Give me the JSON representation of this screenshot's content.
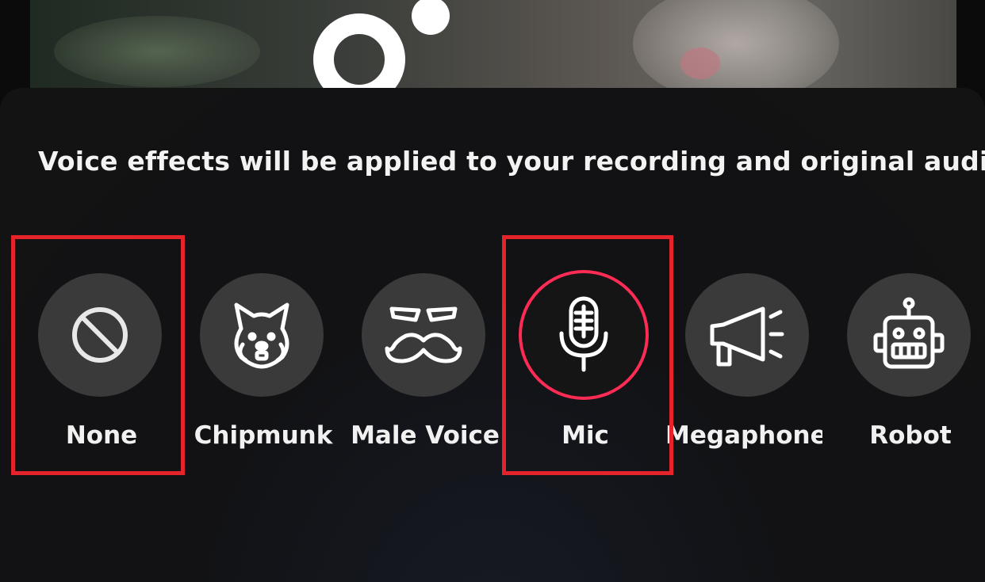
{
  "notice": "Voice effects will be applied to your recording and original audio",
  "effects": [
    {
      "label": "None",
      "icon": "none-icon",
      "selected": false
    },
    {
      "label": "Chipmunk",
      "icon": "chipmunk-icon",
      "selected": false
    },
    {
      "label": "Male Voice",
      "icon": "mustache-icon",
      "selected": false
    },
    {
      "label": "Mic",
      "icon": "microphone-icon",
      "selected": true
    },
    {
      "label": "Megaphone",
      "icon": "megaphone-icon",
      "selected": false
    },
    {
      "label": "Robot",
      "icon": "robot-icon",
      "selected": false
    }
  ],
  "colors": {
    "accent": "#fe2c55",
    "annotation": "#e5232b",
    "sheet_background": "#131314",
    "circle": "#3a3a3b"
  }
}
